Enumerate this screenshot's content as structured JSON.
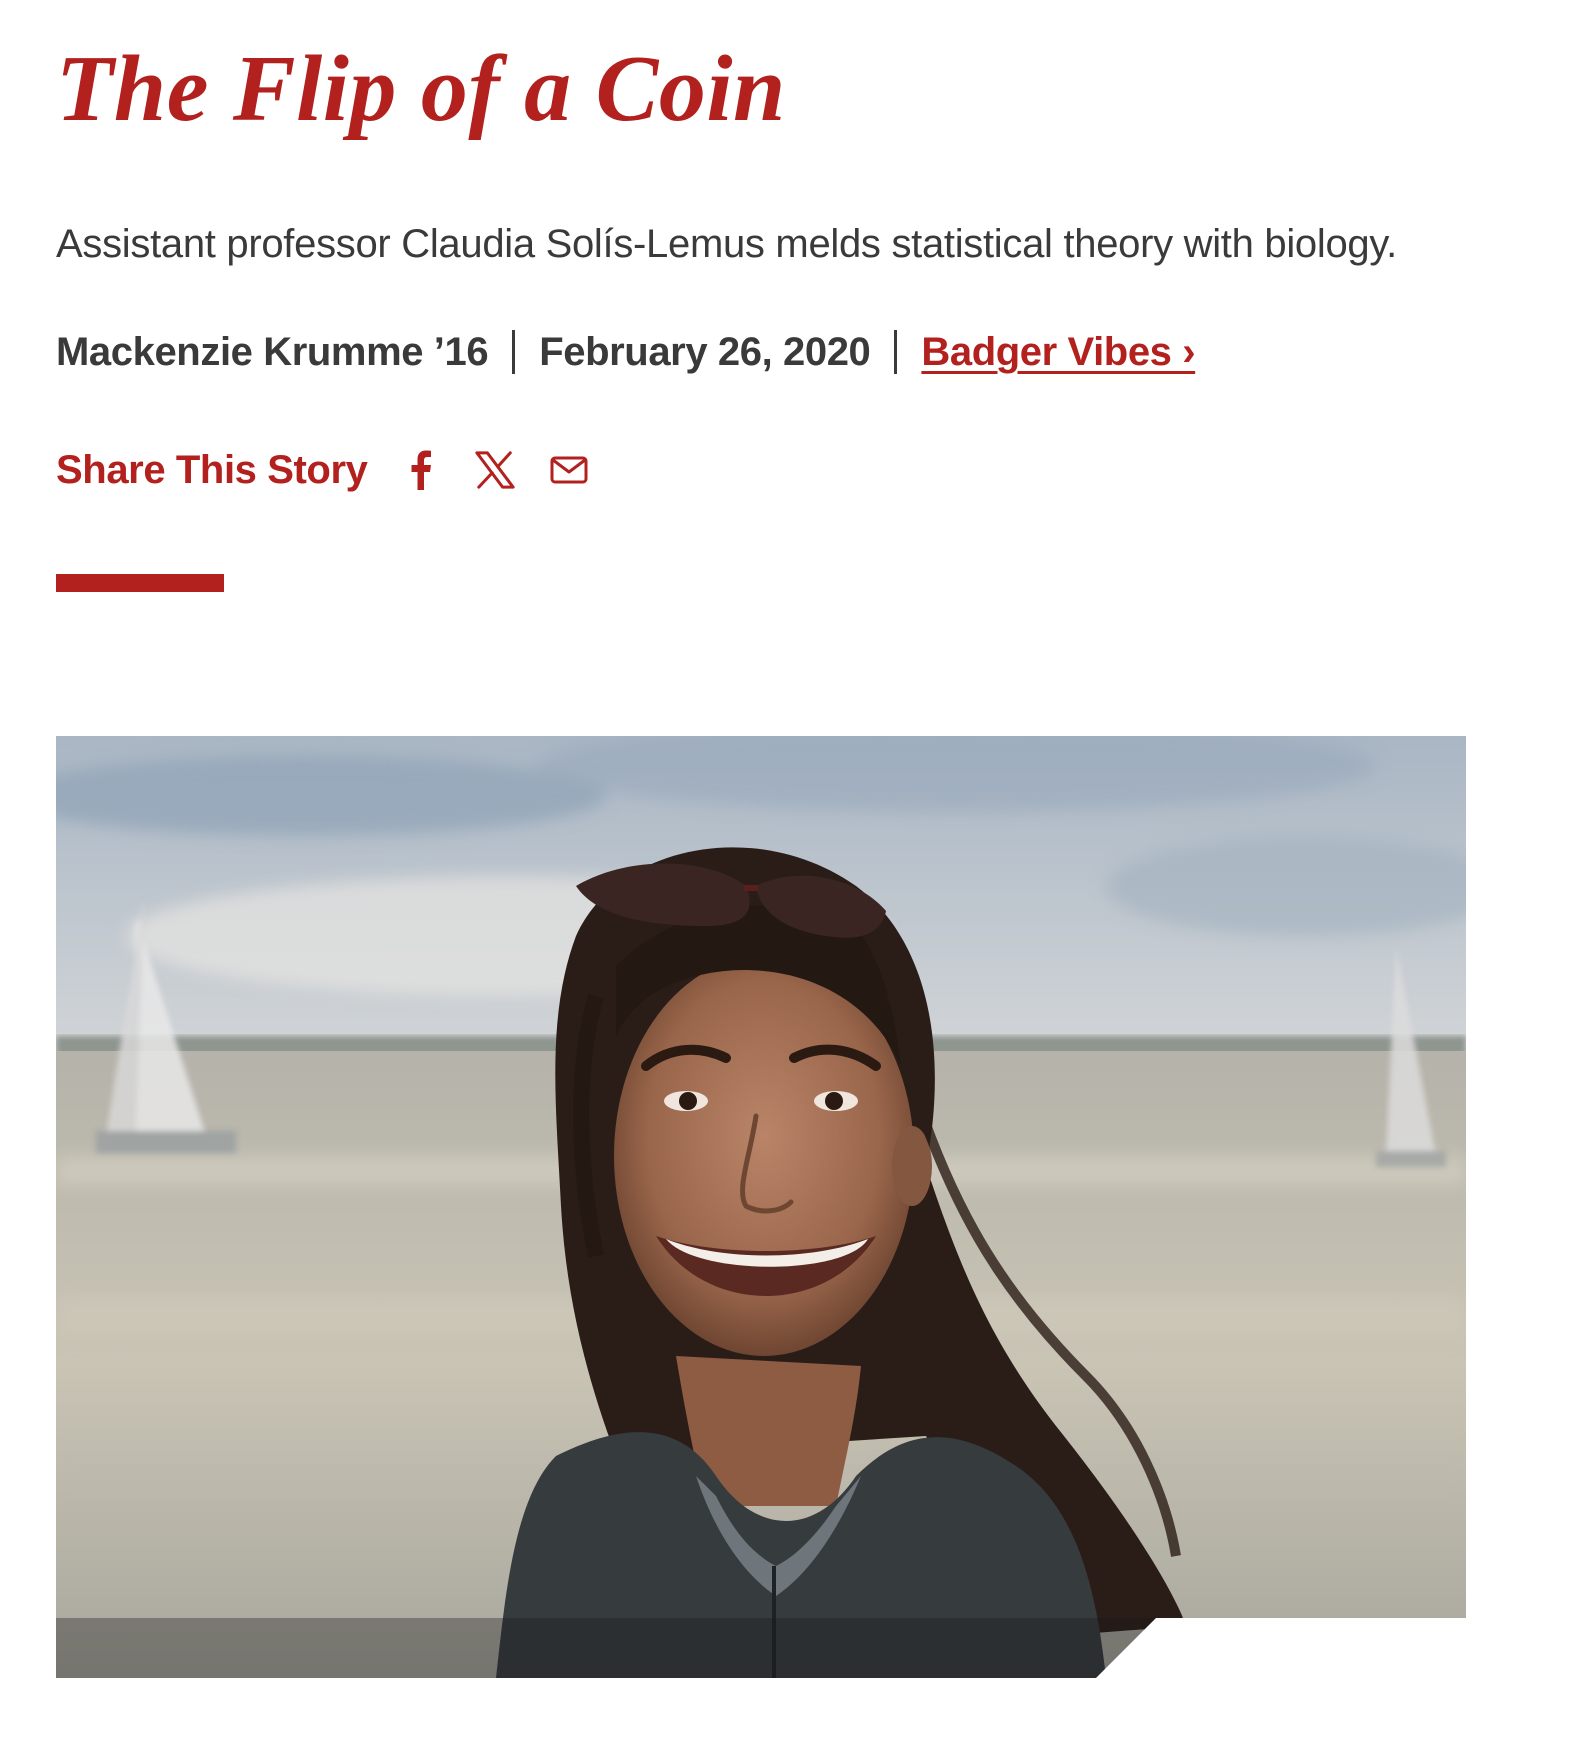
{
  "article": {
    "title": "The Flip of a Coin",
    "deck": "Assistant professor Claudia Solís-Lemus melds statistical theory with biology.",
    "author": "Mackenzie Krumme ’16",
    "date": "February 26, 2020",
    "category": "Badger Vibes ›"
  },
  "share": {
    "label": "Share This Story",
    "icons": [
      "facebook-icon",
      "x-icon",
      "email-icon"
    ]
  },
  "colors": {
    "accent": "#b3211f",
    "text": "#3a3a3a"
  },
  "hero": {
    "description_icon": "portrait-photo"
  }
}
